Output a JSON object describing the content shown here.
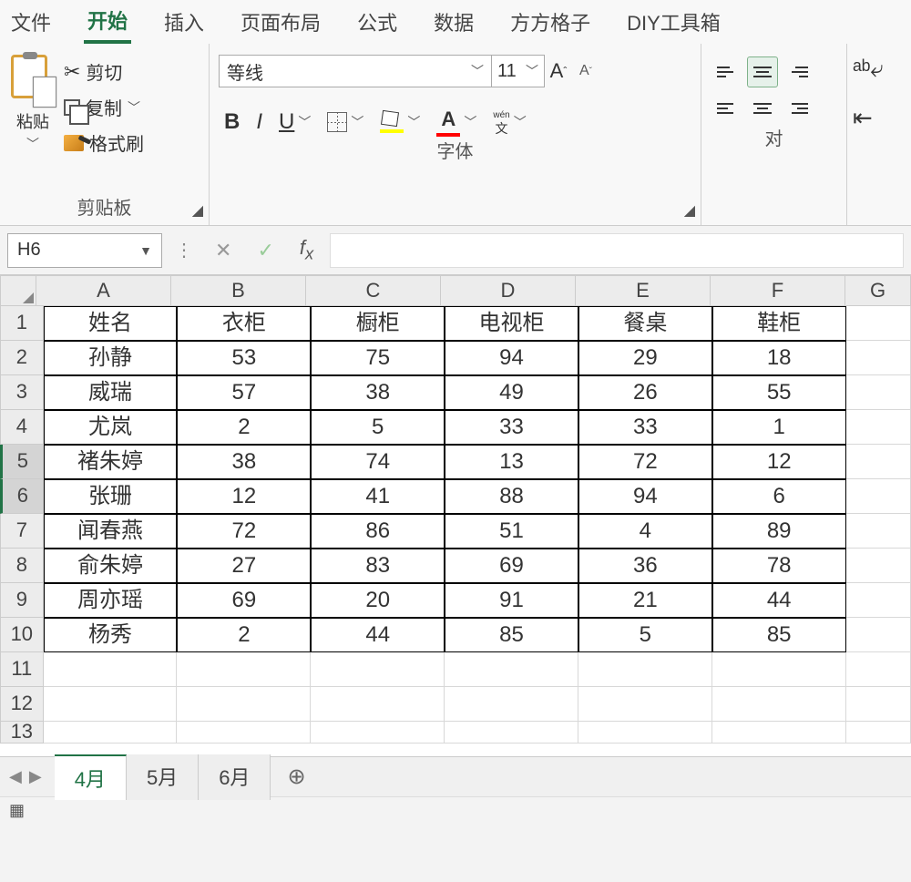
{
  "menu": {
    "items": [
      "文件",
      "开始",
      "插入",
      "页面布局",
      "公式",
      "数据",
      "方方格子",
      "DIY工具箱"
    ],
    "active_index": 1
  },
  "ribbon": {
    "clipboard": {
      "label": "剪贴板",
      "paste": "粘贴",
      "cut": "剪切",
      "copy": "复制",
      "format_painter": "格式刷"
    },
    "font": {
      "label": "字体",
      "name": "等线",
      "size": "11"
    }
  },
  "align_label_partial": "对",
  "namebox": "H6",
  "formula": "",
  "columns": [
    "A",
    "B",
    "C",
    "D",
    "E",
    "F",
    "G"
  ],
  "rows": [
    "1",
    "2",
    "3",
    "4",
    "5",
    "6",
    "7",
    "8",
    "9",
    "10",
    "11",
    "12",
    "13"
  ],
  "selected_rows": [
    5,
    6
  ],
  "table": {
    "header": [
      "姓名",
      "衣柜",
      "橱柜",
      "电视柜",
      "餐桌",
      "鞋柜"
    ],
    "data": [
      [
        "孙静",
        "53",
        "75",
        "94",
        "29",
        "18"
      ],
      [
        "威瑞",
        "57",
        "38",
        "49",
        "26",
        "55"
      ],
      [
        "尤岚",
        "2",
        "5",
        "33",
        "33",
        "1"
      ],
      [
        "褚朱婷",
        "38",
        "74",
        "13",
        "72",
        "12"
      ],
      [
        "张珊",
        "12",
        "41",
        "88",
        "94",
        "6"
      ],
      [
        "闻春燕",
        "72",
        "86",
        "51",
        "4",
        "89"
      ],
      [
        "俞朱婷",
        "27",
        "83",
        "69",
        "36",
        "78"
      ],
      [
        "周亦瑶",
        "69",
        "20",
        "91",
        "21",
        "44"
      ],
      [
        "杨秀",
        "2",
        "44",
        "85",
        "5",
        "85"
      ]
    ]
  },
  "sheets": {
    "items": [
      "4月",
      "5月",
      "6月"
    ],
    "active_index": 0
  },
  "chart_data": {
    "type": "table",
    "columns": [
      "姓名",
      "衣柜",
      "橱柜",
      "电视柜",
      "餐桌",
      "鞋柜"
    ],
    "rows": [
      {
        "姓名": "孙静",
        "衣柜": 53,
        "橱柜": 75,
        "电视柜": 94,
        "餐桌": 29,
        "鞋柜": 18
      },
      {
        "姓名": "威瑞",
        "衣柜": 57,
        "橱柜": 38,
        "电视柜": 49,
        "餐桌": 26,
        "鞋柜": 55
      },
      {
        "姓名": "尤岚",
        "衣柜": 2,
        "橱柜": 5,
        "电视柜": 33,
        "餐桌": 33,
        "鞋柜": 1
      },
      {
        "姓名": "褚朱婷",
        "衣柜": 38,
        "橱柜": 74,
        "电视柜": 13,
        "餐桌": 72,
        "鞋柜": 12
      },
      {
        "姓名": "张珊",
        "衣柜": 12,
        "橱柜": 41,
        "电视柜": 88,
        "餐桌": 94,
        "鞋柜": 6
      },
      {
        "姓名": "闻春燕",
        "衣柜": 72,
        "橱柜": 86,
        "电视柜": 51,
        "餐桌": 4,
        "鞋柜": 89
      },
      {
        "姓名": "俞朱婷",
        "衣柜": 27,
        "橱柜": 83,
        "电视柜": 69,
        "餐桌": 36,
        "鞋柜": 78
      },
      {
        "姓名": "周亦瑶",
        "衣柜": 69,
        "橱柜": 20,
        "电视柜": 91,
        "餐桌": 21,
        "鞋柜": 44
      },
      {
        "姓名": "杨秀",
        "衣柜": 2,
        "橱柜": 44,
        "电视柜": 85,
        "餐桌": 5,
        "鞋柜": 85
      }
    ]
  }
}
